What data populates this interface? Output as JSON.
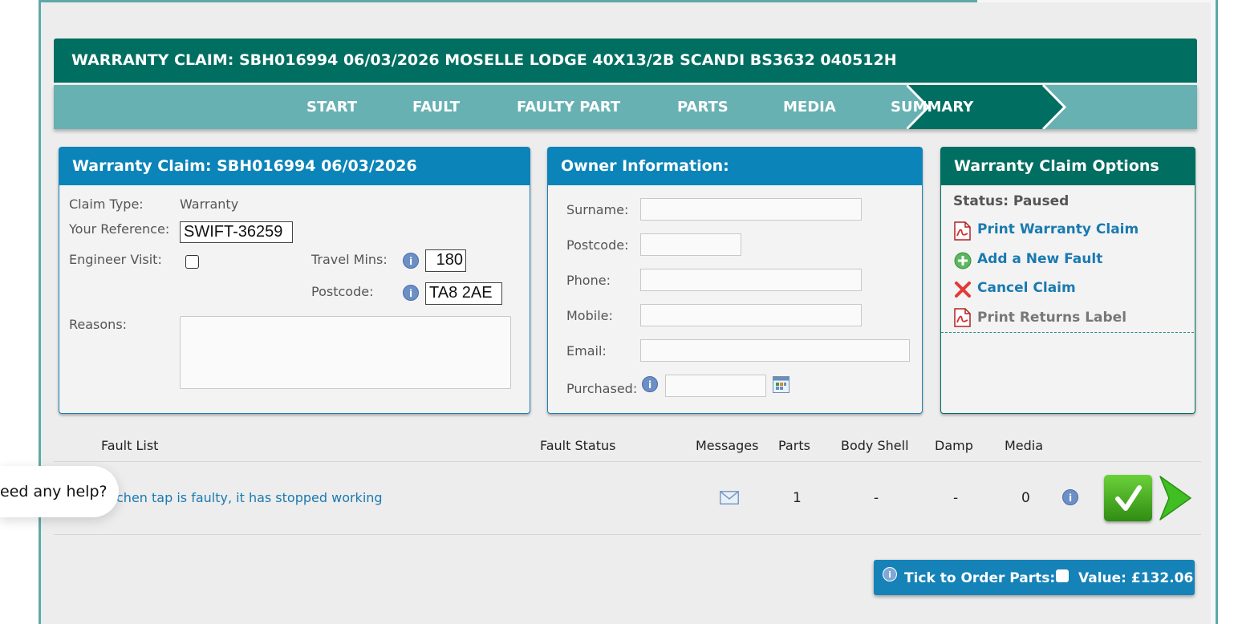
{
  "claim": {
    "title": "WARRANTY CLAIM: SBH016994 06/03/2026 MOSELLE LODGE 40X13/2B SCANDI BS3632 040512H"
  },
  "steps": [
    "START",
    "FAULT",
    "FAULTY PART",
    "PARTS",
    "MEDIA",
    "SUMMARY"
  ],
  "claim_panel": {
    "title": "Warranty Claim: SBH016994 06/03/2026",
    "claim_type_label": "Claim Type:",
    "claim_type_value": "Warranty",
    "reference_label": "Your Reference:",
    "reference_value": "SWIFT-36259",
    "engineer_label": "Engineer Visit:",
    "travel_label": "Travel Mins:",
    "travel_value": "180",
    "postcode_label": "Postcode:",
    "postcode_value": "TA8 2AE",
    "reasons_label": "Reasons:"
  },
  "owner_panel": {
    "title": "Owner Information:",
    "surname_label": "Surname:",
    "postcode_label": "Postcode:",
    "phone_label": "Phone:",
    "mobile_label": "Mobile:",
    "email_label": "Email:",
    "purchased_label": "Purchased:"
  },
  "options_panel": {
    "title": "Warranty Claim Options",
    "status": "Status: Paused",
    "print_claim": "Print Warranty Claim",
    "add_fault": "Add a New Fault",
    "cancel_claim": "Cancel Claim",
    "print_returns": "Print Returns Label"
  },
  "fault_table": {
    "headers": [
      "Fault List",
      "Fault Status",
      "Messages",
      "Parts",
      "Body Shell",
      "Damp",
      "Media"
    ],
    "row": {
      "fault": "chen tap is faulty, it has stopped working",
      "status": "",
      "parts": "1",
      "body_shell": "-",
      "damp": "-",
      "media": "0"
    }
  },
  "help": {
    "text": "eed any help?"
  },
  "order": {
    "label": "Tick to Order Parts:",
    "value": "Value: £132.06"
  },
  "colors": {
    "header_teal": "#006e60",
    "step_teal": "#67b1b3",
    "panel_blue": "#0b84b9",
    "link_blue": "#1a7ab0",
    "accept_green": "#3a9a1a"
  }
}
